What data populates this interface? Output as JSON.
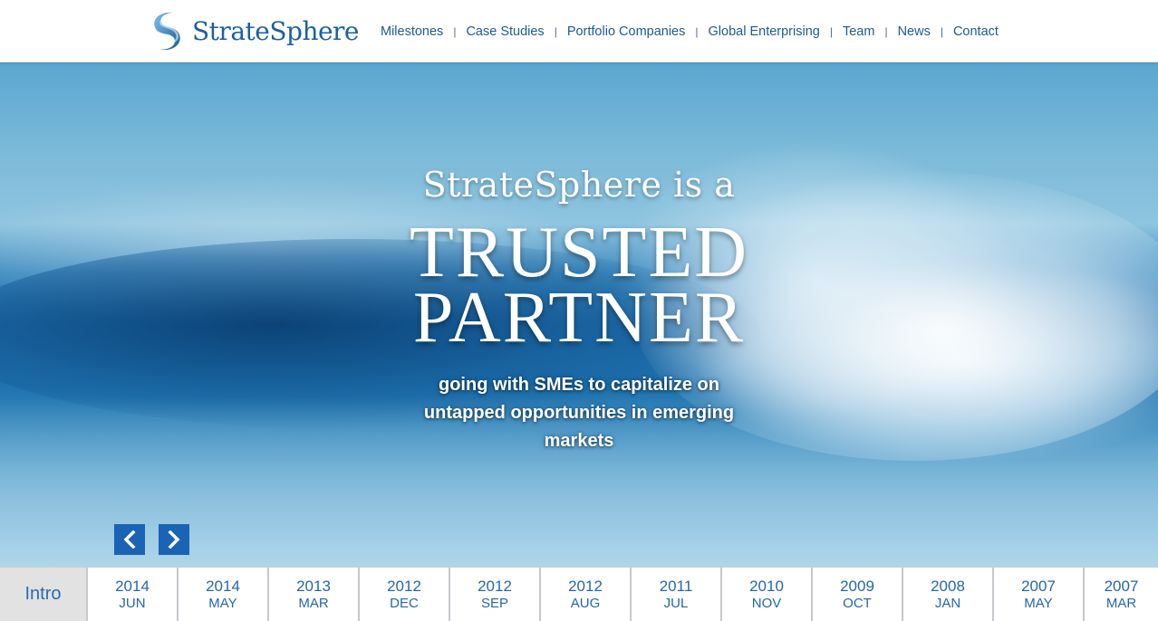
{
  "brand": {
    "name": "StrateSphere",
    "logo_icon": "swirl-logo-icon",
    "color": "#1e5fa0"
  },
  "nav": {
    "items": [
      {
        "label": "Milestones"
      },
      {
        "label": "Case Studies"
      },
      {
        "label": "Portfolio Companies"
      },
      {
        "label": "Global Enterprising"
      },
      {
        "label": "Team"
      },
      {
        "label": "News"
      },
      {
        "label": "Contact"
      }
    ],
    "separator": "|"
  },
  "hero": {
    "line1": "StrateSphere is a",
    "line2": "TRUSTED",
    "line3": "PARTNER",
    "tagline": "going with SMEs to capitalize on untapped opportunities in emerging markets",
    "prev_icon": "chevron-left-icon",
    "next_icon": "chevron-right-icon",
    "button_color": "#1b63b4"
  },
  "timeline": {
    "intro_label": "Intro",
    "items": [
      {
        "year": "2014",
        "month": "JUN"
      },
      {
        "year": "2014",
        "month": "MAY"
      },
      {
        "year": "2013",
        "month": "MAR"
      },
      {
        "year": "2012",
        "month": "DEC"
      },
      {
        "year": "2012",
        "month": "SEP"
      },
      {
        "year": "2012",
        "month": "AUG"
      },
      {
        "year": "2011",
        "month": "JUL"
      },
      {
        "year": "2010",
        "month": "NOV"
      },
      {
        "year": "2009",
        "month": "OCT"
      },
      {
        "year": "2008",
        "month": "JAN"
      },
      {
        "year": "2007",
        "month": "MAY"
      },
      {
        "year": "2007",
        "month": "MAR"
      }
    ]
  }
}
